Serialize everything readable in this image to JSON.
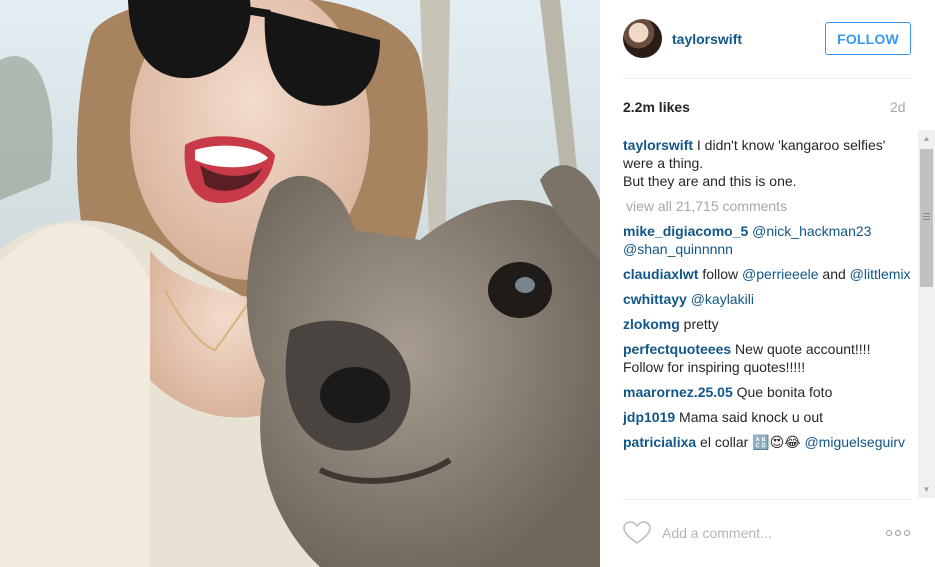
{
  "post": {
    "username": "taylorswift",
    "follow_label": "FOLLOW",
    "likes": "2.2m likes",
    "time_ago": "2d",
    "caption_user": "taylorswift",
    "caption_line1": "I didn't know 'kangaroo selfies' were a thing.",
    "caption_line2": "But they are and this is one.",
    "view_all": "view all 21,715 comments",
    "comments": [
      {
        "user": "mike_digiacomo_5",
        "text": "",
        "mention": "@nick_hackman23 @shan_quinnnnn"
      },
      {
        "user": "claudiaxlwt",
        "text": "follow",
        "mention": "@perrieeele",
        "text2": "and",
        "mention2": "@littlemix"
      },
      {
        "user": "cwhittayy",
        "text": "",
        "mention": "@kaylakili"
      },
      {
        "user": "zlokomg",
        "text": "pretty"
      },
      {
        "user": "perfectquoteees",
        "text": "New quote account!!!! Follow for inspiring quotes!!!!!"
      },
      {
        "user": "maarornez.25.05",
        "text": "Que bonita foto"
      },
      {
        "user": "jdp1019",
        "text": "Mama said knock u out"
      },
      {
        "user": "patricialixa",
        "text": "el collar 🔠😍😂",
        "mention": "@miguelseguirv"
      }
    ],
    "comment_placeholder": "Add a comment...",
    "colors": {
      "username": "#125688",
      "follow": "#3897f0",
      "muted": "#a5a7aa"
    }
  }
}
